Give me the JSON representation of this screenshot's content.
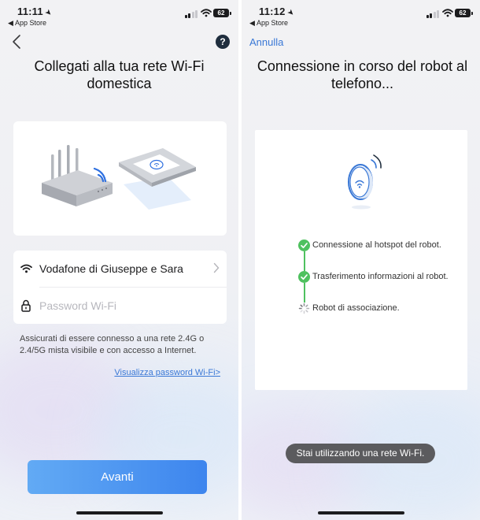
{
  "status_left": {
    "time": "11:11",
    "back_app": "App Store",
    "battery": "62"
  },
  "status_right": {
    "time": "11:12",
    "back_app": "App Store",
    "battery": "62"
  },
  "left": {
    "help_label": "?",
    "title": "Collegati alla tua rete Wi-Fi domestica",
    "network_name": "Vodafone di Giuseppe e Sara",
    "password_placeholder": "Password Wi-Fi",
    "hint": "Assicurati di essere connesso a una rete 2.4G o 2.4/5G mista visibile e con accesso a Internet.",
    "show_password_link": "Visualizza password Wi-Fi>",
    "next_button": "Avanti"
  },
  "right": {
    "cancel": "Annulla",
    "title": "Connessione in corso del robot al telefono...",
    "steps": [
      {
        "label": "Connessione al hotspot del robot.",
        "state": "done"
      },
      {
        "label": "Trasferimento informazioni al robot.",
        "state": "done"
      },
      {
        "label": "Robot di associazione.",
        "state": "loading"
      }
    ],
    "toast": "Stai utilizzando una rete Wi-Fi."
  },
  "colors": {
    "accent": "#3a78d6",
    "success": "#4fc15f",
    "button_from": "#62aaf4",
    "button_to": "#3d85ee"
  },
  "icons": [
    "location-arrow-icon",
    "wifi-icon",
    "back-chevron-icon",
    "help-icon",
    "lock-icon",
    "chevron-right-icon",
    "check-icon",
    "spinner-icon",
    "router-illustration",
    "robot-vacuum-illustration"
  ]
}
